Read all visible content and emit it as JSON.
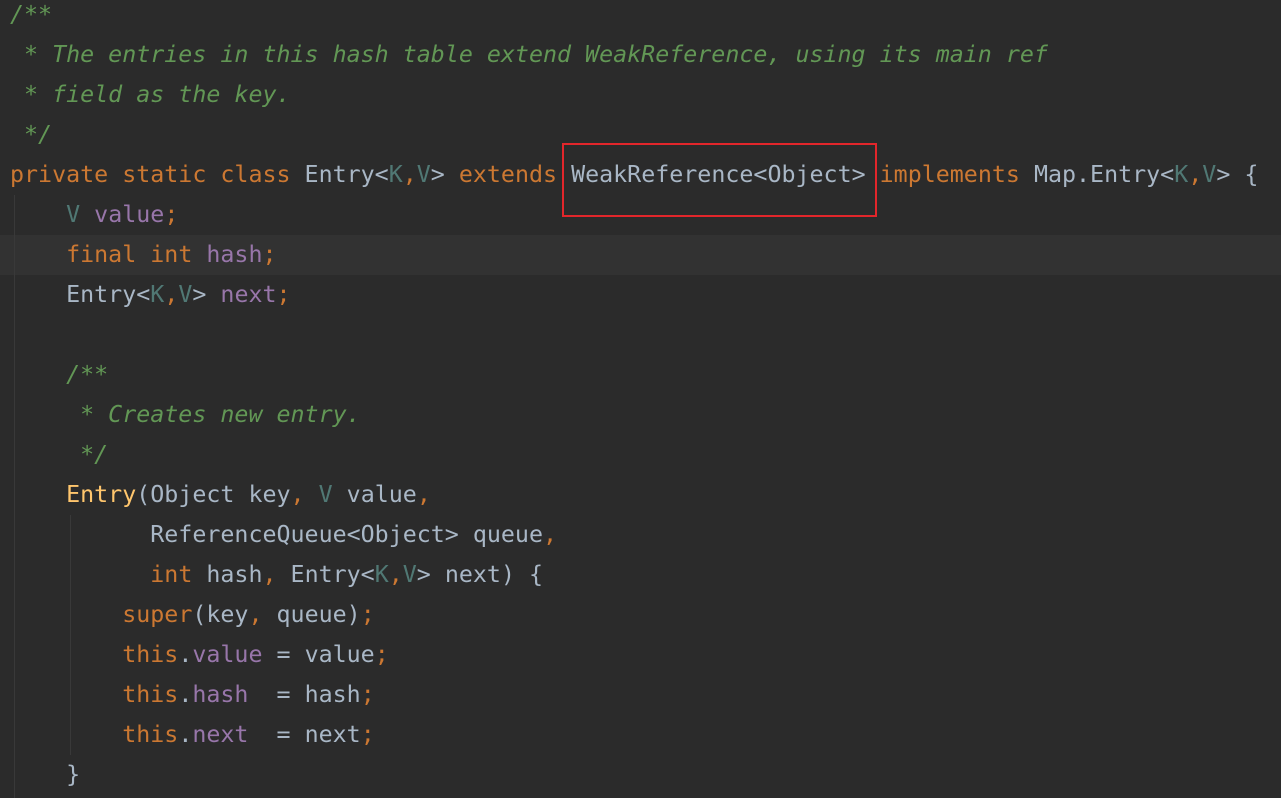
{
  "colors": {
    "background": "#2b2b2b",
    "current_line": "#323232",
    "comment": "#629755",
    "keyword": "#cc7832",
    "field": "#9876aa",
    "type_param": "#507874",
    "method": "#ffc66d",
    "text": "#a9b7c6",
    "highlight_box": "#e3262b"
  },
  "code_lines": [
    {
      "tokens": [
        {
          "t": "/**",
          "c": "comment"
        }
      ]
    },
    {
      "tokens": [
        {
          "t": " * The entries in this hash table extend WeakReference, using its main ref",
          "c": "comment"
        }
      ]
    },
    {
      "tokens": [
        {
          "t": " * field as the key.",
          "c": "comment"
        }
      ]
    },
    {
      "tokens": [
        {
          "t": " */",
          "c": "comment"
        }
      ]
    },
    {
      "tokens": [
        {
          "t": "private static class ",
          "c": "keyword"
        },
        {
          "t": "Entry<",
          "c": "type"
        },
        {
          "t": "K",
          "c": "typeparam"
        },
        {
          "t": ",",
          "c": "punct"
        },
        {
          "t": "V",
          "c": "typeparam"
        },
        {
          "t": "> ",
          "c": "type"
        },
        {
          "t": "extends ",
          "c": "keyword"
        },
        {
          "t": "WeakReference<Object> ",
          "c": "type"
        },
        {
          "t": "implements ",
          "c": "keyword"
        },
        {
          "t": "Map.Entry<",
          "c": "type"
        },
        {
          "t": "K",
          "c": "typeparam"
        },
        {
          "t": ",",
          "c": "punct"
        },
        {
          "t": "V",
          "c": "typeparam"
        },
        {
          "t": "> {",
          "c": "type"
        }
      ]
    },
    {
      "tokens": [
        {
          "t": "    ",
          "c": "plain"
        },
        {
          "t": "V ",
          "c": "typeparam"
        },
        {
          "t": "value",
          "c": "field"
        },
        {
          "t": ";",
          "c": "punct"
        }
      ]
    },
    {
      "current": true,
      "tokens": [
        {
          "t": "    ",
          "c": "plain"
        },
        {
          "t": "final int ",
          "c": "keyword"
        },
        {
          "t": "hash",
          "c": "field"
        },
        {
          "t": ";",
          "c": "punct"
        }
      ]
    },
    {
      "tokens": [
        {
          "t": "    ",
          "c": "plain"
        },
        {
          "t": "Entry<",
          "c": "type"
        },
        {
          "t": "K",
          "c": "typeparam"
        },
        {
          "t": ",",
          "c": "punct"
        },
        {
          "t": "V",
          "c": "typeparam"
        },
        {
          "t": "> ",
          "c": "type"
        },
        {
          "t": "next",
          "c": "field"
        },
        {
          "t": ";",
          "c": "punct"
        }
      ]
    },
    {
      "tokens": []
    },
    {
      "tokens": [
        {
          "t": "    /**",
          "c": "comment"
        }
      ]
    },
    {
      "tokens": [
        {
          "t": "     * Creates new entry.",
          "c": "comment"
        }
      ]
    },
    {
      "tokens": [
        {
          "t": "     */",
          "c": "comment"
        }
      ]
    },
    {
      "tokens": [
        {
          "t": "    ",
          "c": "plain"
        },
        {
          "t": "Entry",
          "c": "method"
        },
        {
          "t": "(Object key",
          "c": "plain"
        },
        {
          "t": ", ",
          "c": "punct"
        },
        {
          "t": "V ",
          "c": "typeparam"
        },
        {
          "t": "value",
          "c": "plain"
        },
        {
          "t": ",",
          "c": "punct"
        }
      ]
    },
    {
      "tokens": [
        {
          "t": "          ReferenceQueue<Object> queue",
          "c": "plain"
        },
        {
          "t": ",",
          "c": "punct"
        }
      ]
    },
    {
      "tokens": [
        {
          "t": "          ",
          "c": "plain"
        },
        {
          "t": "int ",
          "c": "keyword"
        },
        {
          "t": "hash",
          "c": "plain"
        },
        {
          "t": ", ",
          "c": "punct"
        },
        {
          "t": "Entry<",
          "c": "type"
        },
        {
          "t": "K",
          "c": "typeparam"
        },
        {
          "t": ",",
          "c": "punct"
        },
        {
          "t": "V",
          "c": "typeparam"
        },
        {
          "t": "> next) {",
          "c": "plain"
        }
      ]
    },
    {
      "tokens": [
        {
          "t": "        ",
          "c": "plain"
        },
        {
          "t": "super",
          "c": "keyword"
        },
        {
          "t": "(key",
          "c": "plain"
        },
        {
          "t": ", ",
          "c": "punct"
        },
        {
          "t": "queue)",
          "c": "plain"
        },
        {
          "t": ";",
          "c": "punct"
        }
      ]
    },
    {
      "tokens": [
        {
          "t": "        ",
          "c": "plain"
        },
        {
          "t": "this",
          "c": "keyword"
        },
        {
          "t": ".",
          "c": "plain"
        },
        {
          "t": "value",
          "c": "field"
        },
        {
          "t": " = value",
          "c": "plain"
        },
        {
          "t": ";",
          "c": "punct"
        }
      ]
    },
    {
      "tokens": [
        {
          "t": "        ",
          "c": "plain"
        },
        {
          "t": "this",
          "c": "keyword"
        },
        {
          "t": ".",
          "c": "plain"
        },
        {
          "t": "hash",
          "c": "field"
        },
        {
          "t": "  = hash",
          "c": "plain"
        },
        {
          "t": ";",
          "c": "punct"
        }
      ]
    },
    {
      "tokens": [
        {
          "t": "        ",
          "c": "plain"
        },
        {
          "t": "this",
          "c": "keyword"
        },
        {
          "t": ".",
          "c": "plain"
        },
        {
          "t": "next",
          "c": "field"
        },
        {
          "t": "  = next",
          "c": "plain"
        },
        {
          "t": ";",
          "c": "punct"
        }
      ]
    },
    {
      "tokens": [
        {
          "t": "    }",
          "c": "plain"
        }
      ]
    }
  ]
}
